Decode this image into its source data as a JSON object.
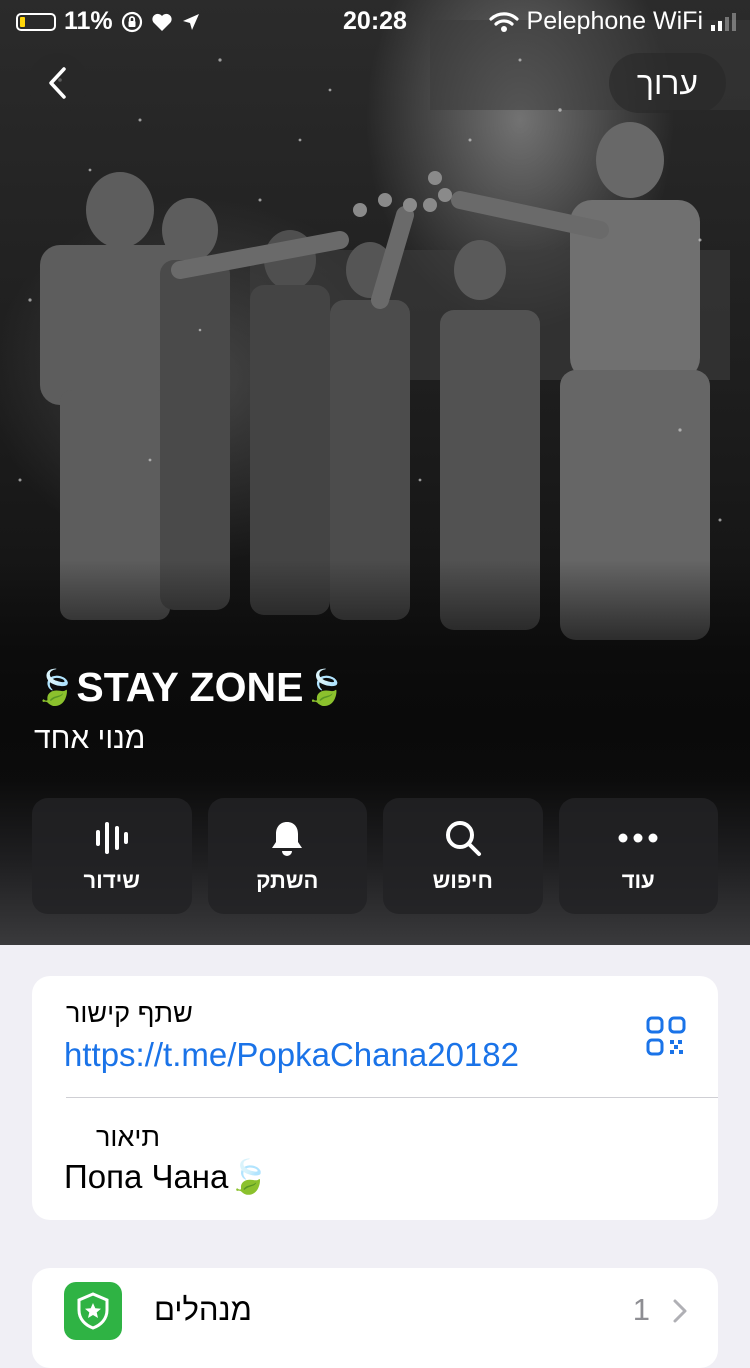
{
  "status_bar": {
    "battery_percent": "11%",
    "battery_level": 0.11,
    "time": "20:28",
    "carrier": "Pelephone WiFi"
  },
  "header": {
    "edit_label": "ערוך"
  },
  "profile": {
    "title": "STAY ZONE",
    "title_emoji": "🍃",
    "subtitle": "מנוי אחד"
  },
  "actions": [
    {
      "label": "שידור",
      "icon": "voice-chat-icon"
    },
    {
      "label": "השתק",
      "icon": "bell-icon"
    },
    {
      "label": "חיפוש",
      "icon": "search-icon"
    },
    {
      "label": "עוד",
      "icon": "more-icon"
    }
  ],
  "info": {
    "share_link_label": "שתף קישור",
    "share_link_url": "https://t.me/PopkaChana20182",
    "description_label": "תיאור",
    "description_value": "Попа Чана",
    "description_emoji": "🍃"
  },
  "admins": {
    "label": "מנהלים",
    "count": "1"
  },
  "colors": {
    "link": "#1a73e8",
    "admin_icon_bg": "#2fb344"
  }
}
